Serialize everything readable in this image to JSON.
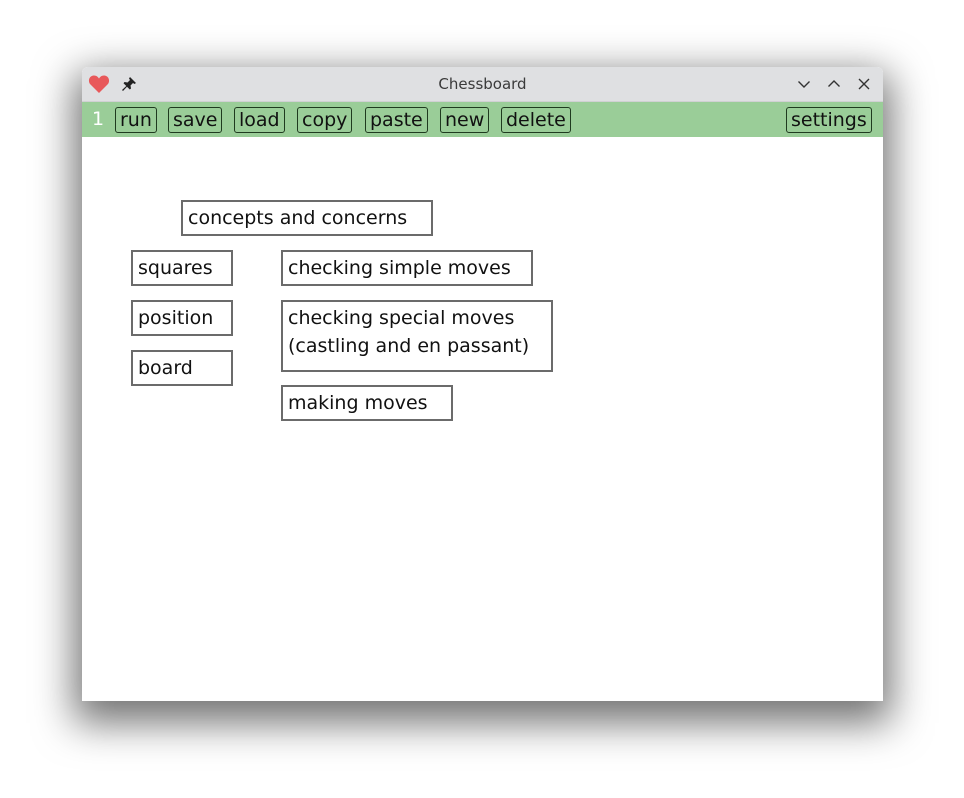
{
  "window": {
    "title": "Chessboard",
    "icons": {
      "left": [
        "heart-icon",
        "pin-icon"
      ],
      "right": [
        "minimize-icon",
        "maximize-icon",
        "close-icon"
      ]
    }
  },
  "toolbar": {
    "tab_number": "1",
    "buttons": [
      {
        "label": "run"
      },
      {
        "label": "save"
      },
      {
        "label": "load"
      },
      {
        "label": "copy"
      },
      {
        "label": "paste"
      },
      {
        "label": "new"
      },
      {
        "label": "delete"
      }
    ],
    "settings_label": "settings",
    "background_color": "#9acd98"
  },
  "canvas": {
    "nodes": [
      {
        "label": "concepts and concerns"
      },
      {
        "label": "squares"
      },
      {
        "label": "position"
      },
      {
        "label": "board"
      },
      {
        "label": "checking simple moves"
      },
      {
        "label_line1": "checking special moves",
        "label_line2": "(castling and en passant)"
      },
      {
        "label": "making moves"
      }
    ]
  }
}
